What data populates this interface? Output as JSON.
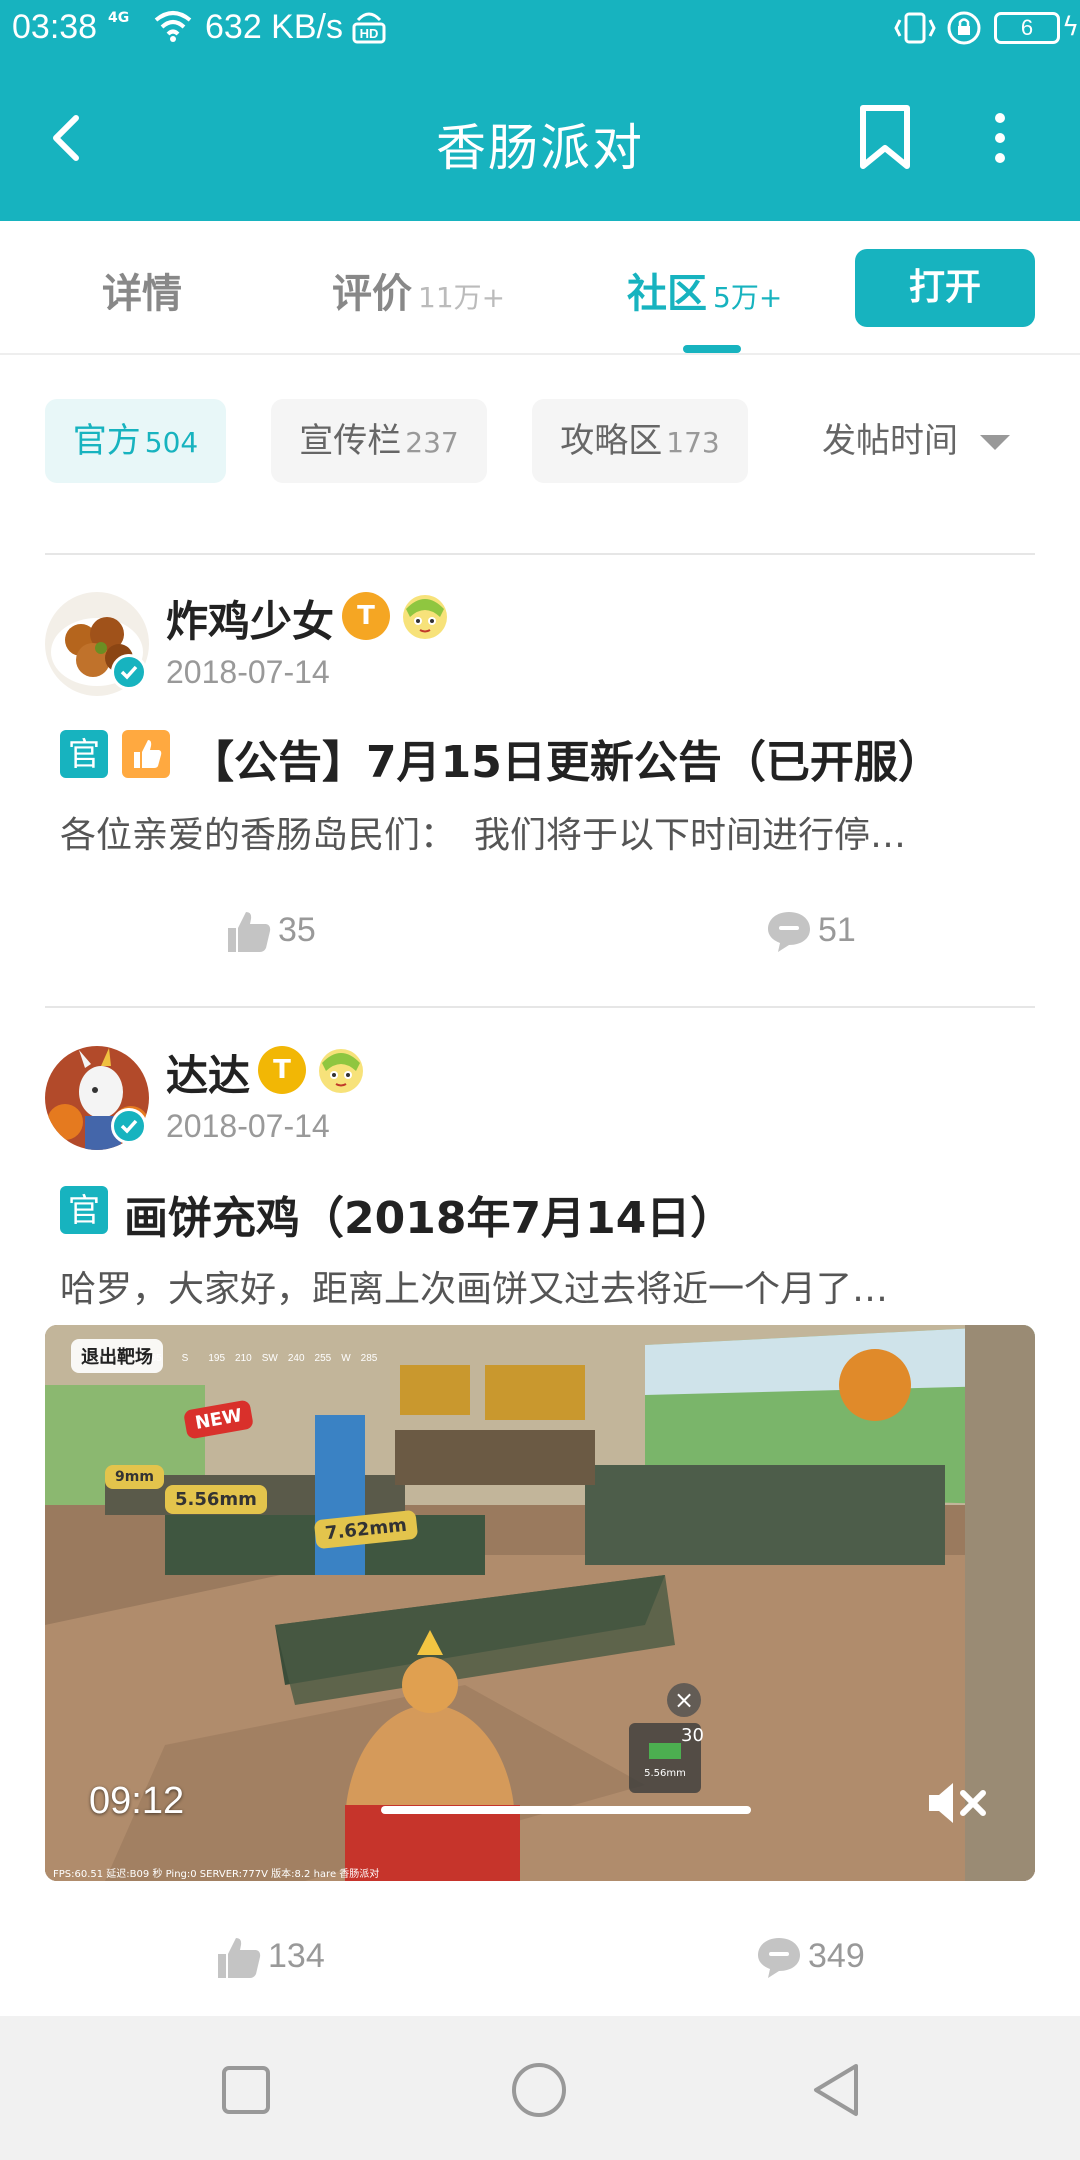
{
  "status_bar": {
    "time": "03:38",
    "network": "4G",
    "speed": "632 KB/s",
    "battery": "6"
  },
  "app_bar": {
    "title": "香肠派对"
  },
  "tabs": [
    {
      "label": "详情",
      "count": ""
    },
    {
      "label": "评价",
      "count": "11万+"
    },
    {
      "label": "社区",
      "count": "5万+"
    }
  ],
  "open_button": "打开",
  "filters": [
    {
      "label": "官方",
      "count": "504"
    },
    {
      "label": "宣传栏",
      "count": "237"
    },
    {
      "label": "攻略区",
      "count": "173"
    }
  ],
  "sort": {
    "label": "发帖时间"
  },
  "posts": [
    {
      "author": "炸鸡少女",
      "date": "2018-07-14",
      "level_badge": "T",
      "tag": "官",
      "title": "【公告】7月15日更新公告（已开服）",
      "excerpt": "各位亲爱的香肠岛民们：　我们将于以下时间进行停…",
      "likes": "35",
      "comments": "51"
    },
    {
      "author": "达达",
      "date": "2018-07-14",
      "level_badge": "T",
      "tag": "官",
      "title": "画饼充鸡（2018年7月14日）",
      "excerpt": "哈罗，大家好，距离上次画饼又过去将近一个月了…",
      "video": {
        "duration": "09:12",
        "label_exit": "退出靶场",
        "label_new": "NEW",
        "label_556": "5.56mm",
        "label_762": "7.62mm",
        "label_9mm": "9mm",
        "ammo": "30",
        "weapon_caption": "5.56mm",
        "hud_text": "FPS:60.51 延迟:B09 秒 Ping:0 SERVER:777V 版本:8.2 hare 香肠派对"
      },
      "likes": "134",
      "comments": "349"
    }
  ],
  "colors": {
    "primary": "#17b3bf",
    "hot_tag": "#ffa940",
    "badge_orange": "#f5a623",
    "badge_gold": "#f2b705"
  },
  "icons": [
    "back-arrow-icon",
    "bookmark-icon",
    "more-vert-icon",
    "thumbs-up-icon",
    "comment-icon",
    "mute-icon",
    "caret-down-icon",
    "nav-square-icon",
    "nav-circle-icon",
    "nav-triangle-icon"
  ]
}
